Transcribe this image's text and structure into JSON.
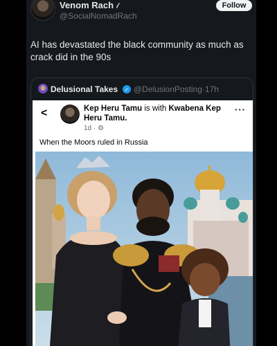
{
  "tweet": {
    "display_name": "Venom Rach",
    "handle": "@SocialNomadRach",
    "follow_label": "Follow",
    "text": "AI has devastated the black community as much as crack did in the 90s"
  },
  "quote": {
    "display_name": "Delusional Takes",
    "handle": "@DelusionPosting",
    "time": "·17h",
    "verified_icon": "check-icon"
  },
  "fb_post": {
    "author": "Kep Heru Tamu",
    "with_text": " is with ",
    "tagged": "Kwabena Kep Heru Tamu.",
    "time": "1d ·",
    "caption": "When the Moors  ruled in Russia",
    "more": "···"
  },
  "colors": {
    "accent": "#1d9bf0",
    "bg": "#15181c",
    "text": "#e7e9ea",
    "muted": "#71767b"
  }
}
